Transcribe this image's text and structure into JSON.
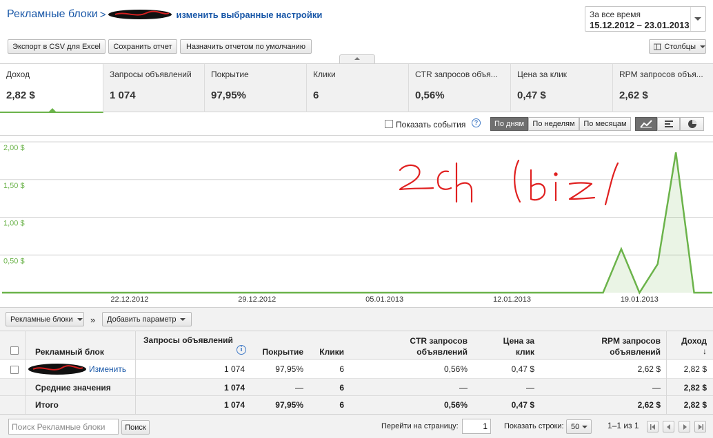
{
  "header": {
    "breadcrumb_root": "Рекламные блоки",
    "breadcrumb_sep": ">",
    "change_settings": "изменить выбранные настройки"
  },
  "date_range": {
    "label": "За все время",
    "value": "15.12.2012 – 23.01.2013"
  },
  "toolbar": {
    "export_csv": "Экспорт в CSV для Excel",
    "save_report": "Сохранить отчет",
    "set_default": "Назначить отчетом по умолчанию",
    "columns": "Столбцы"
  },
  "metrics": [
    {
      "label": "Доход",
      "value": "2,82 $"
    },
    {
      "label": "Запросы объявлений",
      "value": "1 074"
    },
    {
      "label": "Покрытие",
      "value": "97,95%"
    },
    {
      "label": "Клики",
      "value": "6"
    },
    {
      "label": "CTR запросов объя...",
      "value": "0,56%"
    },
    {
      "label": "Цена за клик",
      "value": "0,47 $"
    },
    {
      "label": "RPM запросов объя...",
      "value": "2,62 $"
    }
  ],
  "chart_controls": {
    "show_events": "Показать события",
    "help": "?",
    "by_day": "По дням",
    "by_week": "По неделям",
    "by_month": "По месяцам"
  },
  "chart_data": {
    "type": "area",
    "x": [
      "15.12",
      "16.12",
      "17.12",
      "18.12",
      "19.12",
      "20.12",
      "21.12",
      "22.12",
      "23.12",
      "24.12",
      "25.12",
      "26.12",
      "27.12",
      "28.12",
      "29.12",
      "30.12",
      "31.12",
      "01.01",
      "02.01",
      "03.01",
      "04.01",
      "05.01",
      "06.01",
      "07.01",
      "08.01",
      "09.01",
      "10.01",
      "11.01",
      "12.01",
      "13.01",
      "14.01",
      "15.01",
      "16.01",
      "17.01",
      "18.01",
      "19.01",
      "20.01",
      "21.01",
      "22.01",
      "23.01"
    ],
    "values": [
      0,
      0,
      0,
      0,
      0,
      0,
      0,
      0,
      0,
      0,
      0,
      0,
      0,
      0,
      0,
      0,
      0,
      0,
      0,
      0,
      0,
      0,
      0,
      0,
      0,
      0,
      0,
      0,
      0,
      0,
      0,
      0,
      0,
      0,
      0.58,
      0,
      0.38,
      1.86,
      0,
      0
    ],
    "y_ticks": [
      "2,00 $",
      "1,50 $",
      "1,00 $",
      "0,50 $"
    ],
    "y_tick_values": [
      2.0,
      1.5,
      1.0,
      0.5
    ],
    "ylim": [
      0,
      2.0
    ],
    "x_tick_labels": [
      "22.12.2012",
      "29.12.2012",
      "05.01.2013",
      "12.01.2013",
      "19.01.2013"
    ],
    "x_tick_index": [
      7,
      14,
      21,
      28,
      35
    ],
    "color": "#6bb34a",
    "grid": true,
    "annotation": "2ch /biz/"
  },
  "table_toolbar": {
    "dimension": "Рекламные блоки",
    "add_param": "Добавить параметр",
    "chevron": "»"
  },
  "table": {
    "headers": {
      "name": "Рекламный блок",
      "requests": "Запросы объявлений",
      "coverage": "Покрытие",
      "clicks": "Клики",
      "ctr_1": "CTR запросов",
      "ctr_2": "объявлений",
      "cpc_1": "Цена за",
      "cpc_2": "клик",
      "rpm_1": "RPM запросов",
      "rpm_2": "объявлений",
      "revenue": "Доход",
      "sort_arrow": "↓",
      "info": "i"
    },
    "rows": [
      {
        "name_link": "Изменить",
        "requests": "1 074",
        "coverage": "97,95%",
        "clicks": "6",
        "ctr": "0,56%",
        "cpc": "0,47 $",
        "rpm": "2,62 $",
        "revenue": "2,82 $"
      }
    ],
    "average": {
      "label": "Средние значения",
      "requests": "1 074",
      "coverage": "—",
      "clicks": "6",
      "ctr": "—",
      "cpc": "—",
      "rpm": "—",
      "revenue": "2,82 $"
    },
    "total": {
      "label": "Итого",
      "requests": "1 074",
      "coverage": "97,95%",
      "clicks": "6",
      "ctr": "0,56%",
      "cpc": "0,47 $",
      "rpm": "2,62 $",
      "revenue": "2,82 $"
    }
  },
  "footer": {
    "search_placeholder": "Поиск Рекламные блоки",
    "search_button": "Поиск",
    "goto_page_label": "Перейти на страницу:",
    "page_value": "1",
    "rows_label": "Показать строки:",
    "rows_value": "50",
    "range": "1–1 из 1"
  }
}
